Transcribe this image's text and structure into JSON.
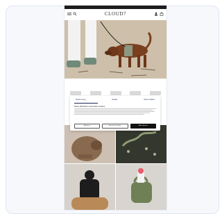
{
  "site": {
    "brand": "CLOUD7"
  },
  "icons": {
    "menu": "menu-icon",
    "search": "search-icon",
    "account": "account-icon",
    "cart": "cart-icon"
  },
  "consent": {
    "tabs": [
      {
        "label": "Zustimmung"
      },
      {
        "label": "Details"
      },
      {
        "label": "Über Cookies"
      }
    ],
    "title": "Diese Webseite verwendet Cookies",
    "buttons": [
      {
        "label": "Ablehnen"
      },
      {
        "label": "Auswahl erlauben"
      },
      {
        "label": "Alle zulassen"
      }
    ]
  },
  "colors": {
    "accent": "#1b2a57",
    "primary_button": "#111111",
    "background_card": "#f6f8fc"
  }
}
